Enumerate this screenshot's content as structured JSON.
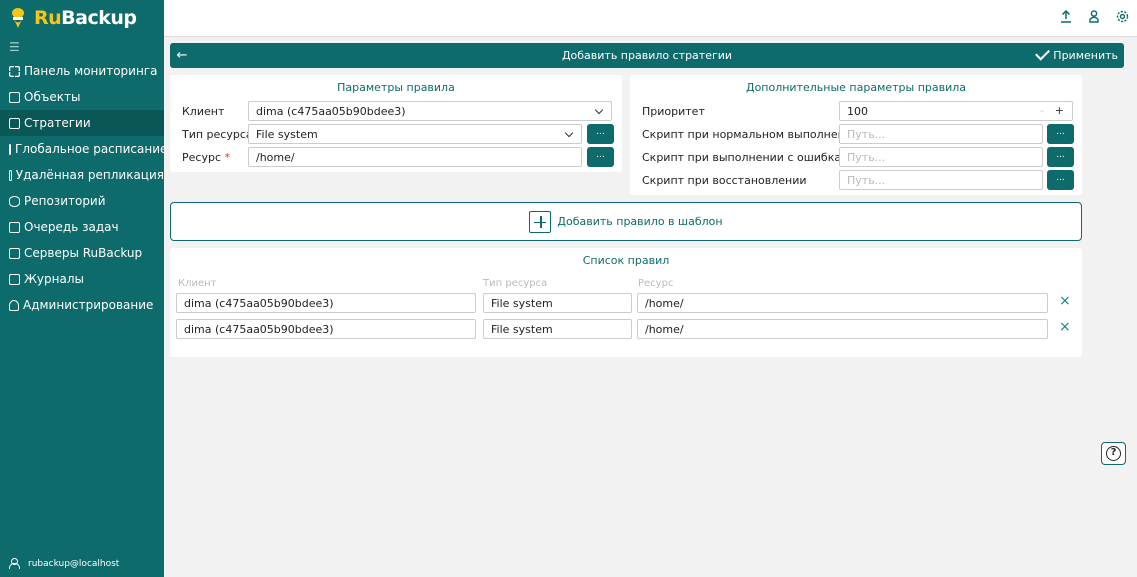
{
  "app": {
    "logo_ru": "Ru",
    "logo_backup": "Backup"
  },
  "sidebar": {
    "collapse_icon": "list-icon",
    "items": [
      {
        "label": "Панель мониторинга",
        "icon": "grid-icon"
      },
      {
        "label": "Объекты",
        "icon": "monitor-icon"
      },
      {
        "label": "Стратегии",
        "icon": "document-icon",
        "active": true
      },
      {
        "label": "Глобальное расписание",
        "icon": "calendar-icon"
      },
      {
        "label": "Удалённая репликация",
        "icon": "replication-icon"
      },
      {
        "label": "Репозиторий",
        "icon": "database-icon"
      },
      {
        "label": "Очередь задач",
        "icon": "queue-icon"
      },
      {
        "label": "Серверы RuBackup",
        "icon": "server-icon"
      },
      {
        "label": "Журналы",
        "icon": "log-icon"
      },
      {
        "label": "Администрирование",
        "icon": "user-icon"
      }
    ],
    "user": "rubackup@localhost"
  },
  "topbar": {
    "icons": [
      "upload-icon",
      "user-icon",
      "settings-icon"
    ]
  },
  "header": {
    "back_icon": "←",
    "title": "Добавить правило стратегии",
    "apply_label": "Применить"
  },
  "rule_params": {
    "title": "Параметры правила",
    "client_label": "Клиент",
    "client_value": "dima (c475aa05b90bdee3)",
    "resource_type_label": "Тип ресурса",
    "resource_type_value": "File system",
    "resource_label": "Ресурс",
    "resource_required": "*",
    "resource_value": "/home/",
    "dots": "..."
  },
  "extra_params": {
    "title": "Дополнительные параметры правила",
    "priority_label": "Приоритет",
    "priority_value": "100",
    "minus": "-",
    "plus": "+",
    "script_ok_label": "Скрипт при нормальном выполнении",
    "script_err_label": "Скрипт при выполнении с ошибками",
    "script_restore_label": "Скрипт при восстановлении",
    "path_placeholder": "Путь..."
  },
  "add_rule": {
    "label": "Добавить правило в шаблон"
  },
  "rules_list": {
    "title": "Список правил",
    "columns": [
      "Клиент",
      "Тип ресурса",
      "Ресурс"
    ],
    "rows": [
      {
        "client": "dima (c475aa05b90bdee3)",
        "type": "File system",
        "resource": "/home/"
      },
      {
        "client": "dima (c475aa05b90bdee3)",
        "type": "File system",
        "resource": "/home/"
      }
    ],
    "delete": "×"
  },
  "help": {
    "label": "?"
  }
}
